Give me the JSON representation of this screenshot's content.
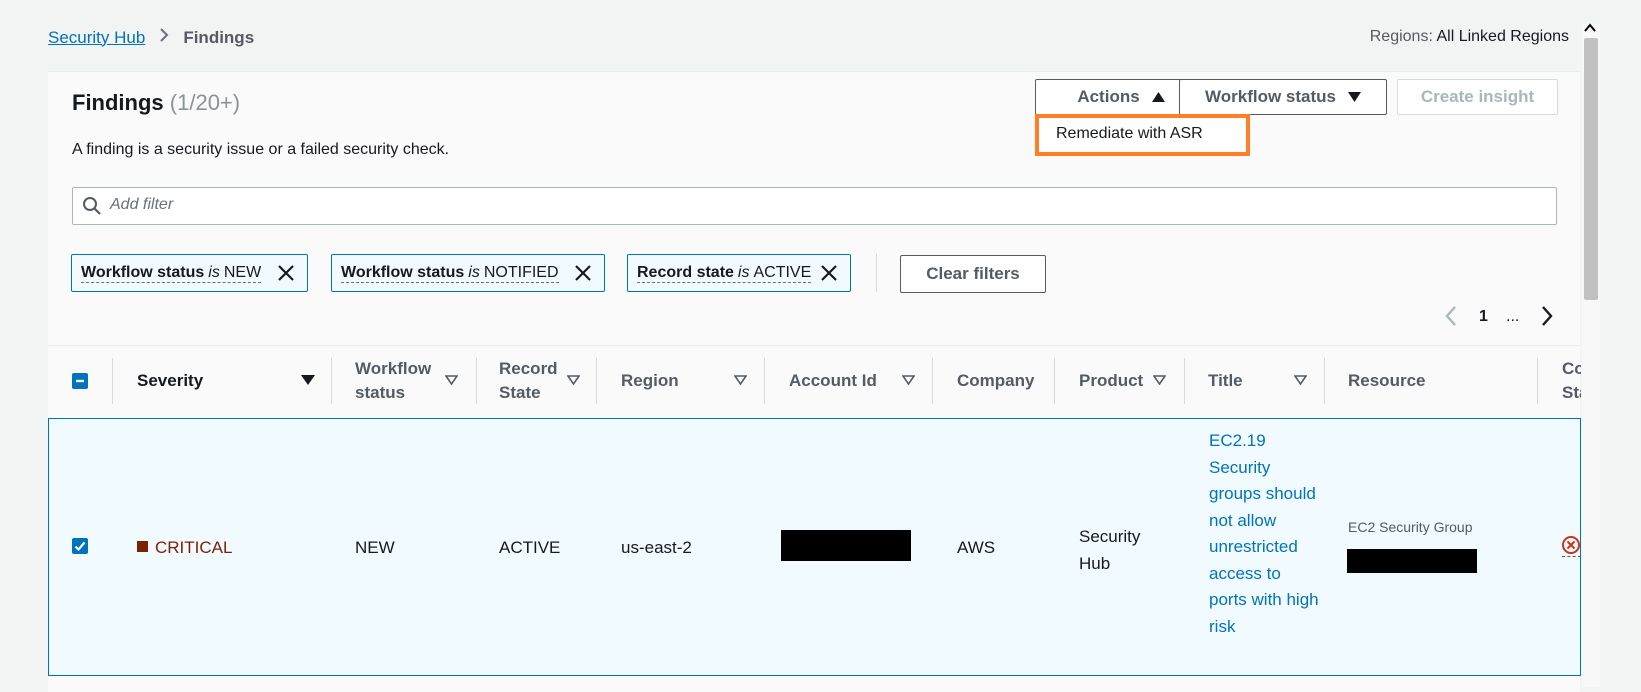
{
  "breadcrumb": {
    "root": "Security Hub",
    "current": "Findings"
  },
  "regions": {
    "label": "Regions:",
    "value": "All Linked Regions"
  },
  "panel": {
    "title": "Findings",
    "count": "(1/20+)",
    "description": "A finding is a security issue or a failed security check."
  },
  "toolbar": {
    "actions_label": "Actions",
    "workflow_label": "Workflow status",
    "create_insight_label": "Create insight"
  },
  "actions_menu": {
    "items": [
      {
        "label": "Remediate with ASR"
      }
    ]
  },
  "search": {
    "placeholder": "Add filter"
  },
  "filters": [
    {
      "field": "Workflow status",
      "op": "is",
      "value": "NEW"
    },
    {
      "field": "Workflow status",
      "op": "is",
      "value": "NOTIFIED"
    },
    {
      "field": "Record state",
      "op": "is",
      "value": "ACTIVE"
    }
  ],
  "clear_filters_label": "Clear filters",
  "pagination": {
    "current": "1",
    "more": "..."
  },
  "table": {
    "columns": {
      "severity": "Severity",
      "workflow_1": "Workflow",
      "workflow_2": "status",
      "record_1": "Record",
      "record_2": "State",
      "region": "Region",
      "account": "Account Id",
      "company": "Company",
      "product": "Product",
      "title": "Title",
      "resource": "Resource",
      "compliance_1": "Co",
      "compliance_2": "Sta"
    },
    "rows": [
      {
        "severity": "CRITICAL",
        "workflow": "NEW",
        "record_state": "ACTIVE",
        "region": "us-east-2",
        "company": "AWS",
        "product_1": "Security",
        "product_2": "Hub",
        "title": "EC2.19 Security groups should not allow unrestricted access to ports with high risk",
        "resource_type": "EC2 Security Group"
      }
    ]
  },
  "colors": {
    "accent": "#0073bb",
    "critical": "#7d2105",
    "highlight": "#ff7f27",
    "failed": "#d13212"
  }
}
